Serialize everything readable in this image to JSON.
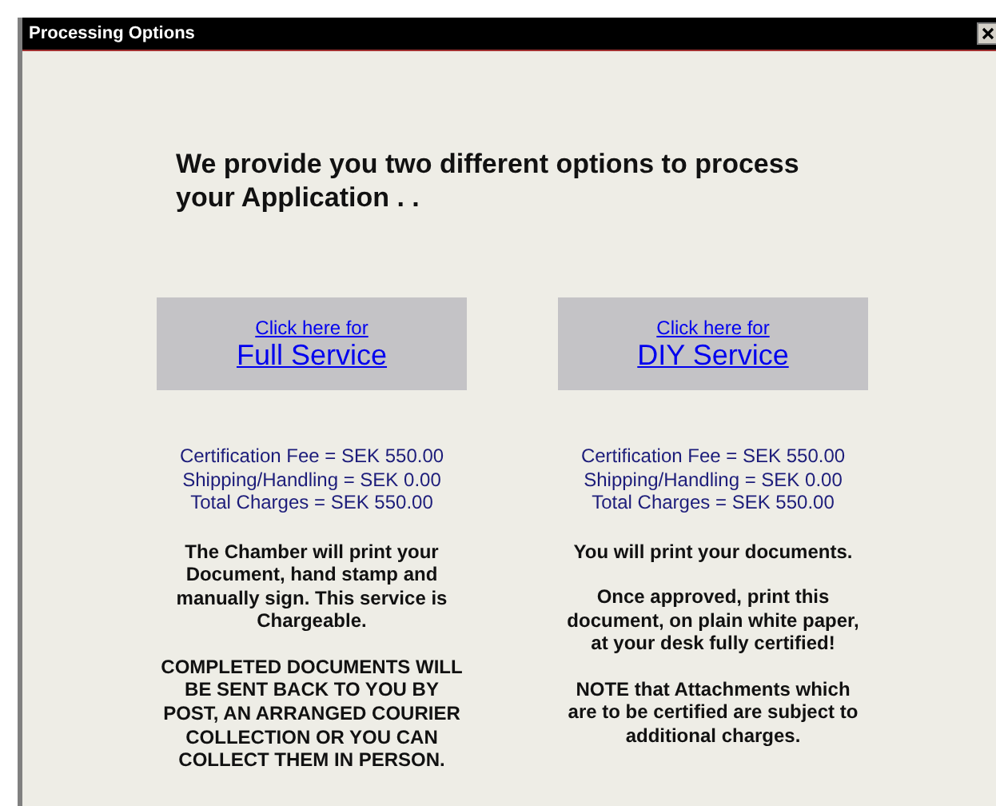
{
  "window": {
    "title": "Processing Options"
  },
  "heading": "We provide you two different options to process your Application . .",
  "options": [
    {
      "link_prefix": "Click here for",
      "link_main": "Full Service",
      "fees": [
        "Certification Fee = SEK 550.00",
        "Shipping/Handling = SEK 0.00",
        "Total Charges = SEK 550.00"
      ],
      "paragraphs": [
        "The Chamber will print your Document, hand stamp and manually sign.  This service is Chargeable.",
        "COMPLETED DOCUMENTS WILL BE SENT BACK TO YOU BY POST, AN ARRANGED COURIER COLLECTION OR YOU CAN COLLECT THEM IN PERSON."
      ]
    },
    {
      "link_prefix": "Click here for",
      "link_main": "DIY Service",
      "fees": [
        "Certification Fee = SEK 550.00",
        "Shipping/Handling = SEK 0.00",
        "Total Charges = SEK 550.00"
      ],
      "paragraphs": [
        "You will print your documents.",
        "Once approved, print this document, on plain white paper, at your desk fully certified!",
        "NOTE that Attachments which are to be certified are subject to additional charges."
      ]
    }
  ]
}
